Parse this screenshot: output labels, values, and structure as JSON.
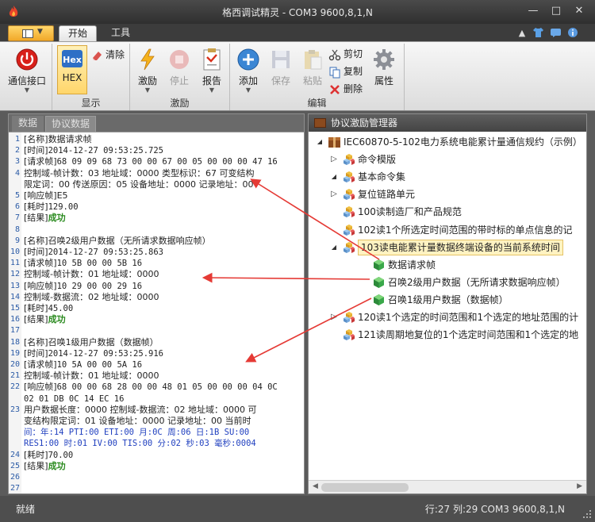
{
  "window": {
    "title": "格西调试精灵 - COM3   9600,8,1,N",
    "controls": [
      "minimize-icon",
      "maximize-icon",
      "close-icon"
    ]
  },
  "ribbon_tabs": [
    {
      "label": "开始",
      "active": true
    },
    {
      "label": "工具",
      "active": false
    }
  ],
  "ribbon": {
    "groups": {
      "display": "显示",
      "excite": "激励",
      "edit": "编辑"
    },
    "buttons": {
      "comm_port": "通信接口",
      "hex": "HEX",
      "hex_badge": "Hex",
      "clear": "清除",
      "excite": "激励",
      "stop": "停止",
      "report": "报告",
      "add": "添加",
      "save": "保存",
      "paste": "粘贴",
      "cut": "剪切",
      "copy": "复制",
      "delete": "删除",
      "properties": "属性"
    }
  },
  "left_pane": {
    "tabs": [
      {
        "label": "数据",
        "active": false
      },
      {
        "label": "协议数据",
        "active": true
      }
    ],
    "lines": [
      {
        "no": "1",
        "tag": "[名称]",
        "text": "数据请求帧"
      },
      {
        "no": "2",
        "tag": "[时间]",
        "text": "2014-12-27 09:53:25.725"
      },
      {
        "no": "3",
        "tag": "[请求帧]",
        "text": "68 09 09 68 73 00 00 67 00 05 00 00 00 47 16"
      },
      {
        "no": "4",
        "tag": "",
        "text": " 控制域-帧计数：03   地址域：0000   类型标识：67   可变结构"
      },
      {
        "no": "",
        "tag": "",
        "text": " 限定词：00   传送原因：05   设备地址：0000   记录地址：00"
      },
      {
        "no": "5",
        "tag": "[响应帧]",
        "text": "E5"
      },
      {
        "no": "6",
        "tag": "[耗时]",
        "text": "129.00"
      },
      {
        "no": "7",
        "tag": "[结果]",
        "text": "成功",
        "ok": true
      },
      {
        "no": "8",
        "tag": "",
        "text": ""
      },
      {
        "no": "9",
        "tag": "[名称]",
        "text": "召唤2级用户数据（无所请求数据响应帧）"
      },
      {
        "no": "10",
        "tag": "[时间]",
        "text": "2014-12-27 09:53:25.863"
      },
      {
        "no": "11",
        "tag": "[请求帧]",
        "text": "10 5B 00 00 5B 16"
      },
      {
        "no": "12",
        "tag": "",
        "text": " 控制域-帧计数：01   地址域：0000"
      },
      {
        "no": "13",
        "tag": "[响应帧]",
        "text": "10 29 00 00 29 16"
      },
      {
        "no": "14",
        "tag": "",
        "text": " 控制域-数据流：02   地址域：0000"
      },
      {
        "no": "15",
        "tag": "[耗时]",
        "text": "45.00"
      },
      {
        "no": "16",
        "tag": "[结果]",
        "text": "成功",
        "ok": true
      },
      {
        "no": "17",
        "tag": "",
        "text": ""
      },
      {
        "no": "18",
        "tag": "[名称]",
        "text": "召唤1级用户数据（数据帧）"
      },
      {
        "no": "19",
        "tag": "[时间]",
        "text": "2014-12-27 09:53:25.916"
      },
      {
        "no": "20",
        "tag": "[请求帧]",
        "text": "10 5A 00 00 5A 16"
      },
      {
        "no": "21",
        "tag": "",
        "text": " 控制域-帧计数：01   地址域：0000"
      },
      {
        "no": "22",
        "tag": "[响应帧]",
        "text": "68 00 00 68 28 00 00 48 01 05 00 00 00 04 0C"
      },
      {
        "no": "",
        "tag": "",
        "text": "02 01 DB 0C 14 EC 16"
      },
      {
        "no": "23",
        "tag": "",
        "text": " 用户数据长度：0000   控制域-数据流：02   地址域：0000   可"
      },
      {
        "no": "",
        "tag": "",
        "text": " 变结构限定词：01   设备地址：0000   记录地址：00   当前时"
      },
      {
        "no": "",
        "tag": "",
        "text": " 间：年:14 PTI:00 ETI:00 月:0C 周:06 日:1B SU:00",
        "blue": true
      },
      {
        "no": "",
        "tag": "",
        "text": " RES1:00 时:01 IV:00 TIS:00 分:02 秒:03 毫秒:0004",
        "blue": true
      },
      {
        "no": "24",
        "tag": "[耗时]",
        "text": "70.00"
      },
      {
        "no": "25",
        "tag": "[结果]",
        "text": "成功",
        "ok": true
      },
      {
        "no": "26",
        "tag": "",
        "text": ""
      },
      {
        "no": "27",
        "tag": "",
        "text": ""
      }
    ]
  },
  "right_pane": {
    "header": "协议激励管理器",
    "tree": [
      {
        "label": "IEC60870-5-102电力系统电能累计量通信规约（示例）",
        "twisty": "expanded",
        "icon": "package-icon",
        "level": 0
      },
      {
        "label": "命令模版",
        "twisty": "collapsed",
        "icon": "command-set-icon",
        "level": 1
      },
      {
        "label": "基本命令集",
        "twisty": "expanded",
        "icon": "command-set-icon",
        "level": 1
      },
      {
        "label": "复位链路单元",
        "twisty": "collapsed",
        "icon": "command-set-icon",
        "level": 2
      },
      {
        "label": "100读制造厂和产品规范",
        "twisty": "none",
        "icon": "command-set-icon",
        "level": 2
      },
      {
        "label": "102读1个所选定时间范围的带时标的单点信息的记",
        "twisty": "none",
        "icon": "command-set-icon",
        "level": 2
      },
      {
        "label": "103读电能累计量数据终端设备的当前系统时间",
        "twisty": "expanded",
        "icon": "command-set-icon",
        "level": 2,
        "selected": true
      },
      {
        "label": "数据请求帧",
        "twisty": "none",
        "icon": "green-cube-icon",
        "level": 3
      },
      {
        "label": "召唤2级用户数据（无所请求数据响应帧）",
        "twisty": "none",
        "icon": "green-cube-icon",
        "level": 3
      },
      {
        "label": "召唤1级用户数据（数据帧）",
        "twisty": "none",
        "icon": "green-cube-icon",
        "level": 3
      },
      {
        "label": "120读1个选定的时间范围和1个选定的地址范围的计",
        "twisty": "collapsed",
        "icon": "command-set-icon",
        "level": 2
      },
      {
        "label": "121读周期地复位的1个选定时间范围和1个选定的地",
        "twisty": "none",
        "icon": "command-set-icon",
        "level": 2
      }
    ]
  },
  "statusbar": {
    "left": "就绪",
    "right": "行:27  列:29     COM3  9600,8,1,N"
  }
}
